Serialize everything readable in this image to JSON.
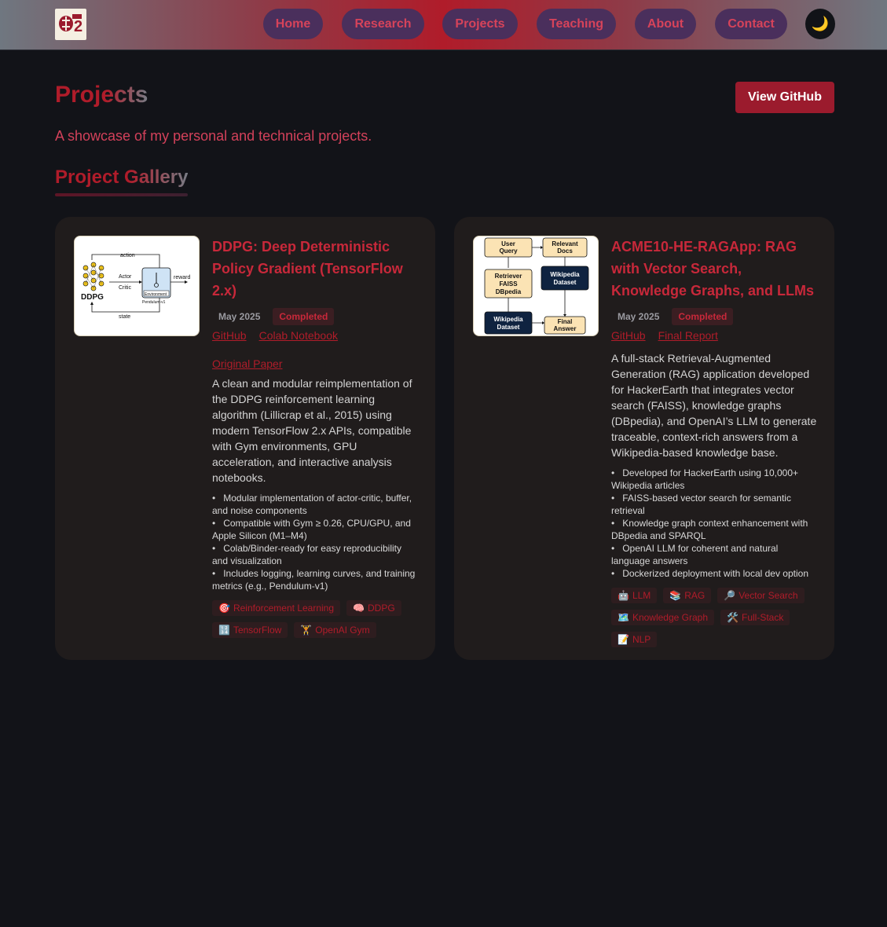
{
  "nav": {
    "logo_label": "logo",
    "items": [
      {
        "label": "Home"
      },
      {
        "label": "Research"
      },
      {
        "label": "Projects"
      },
      {
        "label": "Teaching"
      },
      {
        "label": "About"
      },
      {
        "label": "Contact"
      }
    ],
    "theme_icon": "🌙"
  },
  "page": {
    "title": "Projects",
    "subtitle": "A showcase of my personal and technical projects.",
    "github_button": "View GitHub",
    "section_title": "Project Gallery"
  },
  "projects": [
    {
      "title": "DDPG: Deep Deterministic Policy Gradient (TensorFlow 2.x)",
      "date": "May 2025",
      "status": "Completed",
      "links": [
        "GitHub",
        "Colab Notebook",
        "Original Paper"
      ],
      "description": "A clean and modular reimplementation of the DDPG reinforcement learning algorithm (Lillicrap et al., 2015) using modern TensorFlow 2.x APIs, compatible with Gym environments, GPU acceleration, and interactive analysis notebooks.",
      "features": [
        "Modular implementation of actor-critic, buffer, and noise components",
        "Compatible with Gym ≥ 0.26, CPU/GPU, and Apple Silicon (M1–M4)",
        "Colab/Binder-ready for easy reproducibility and visualization",
        "Includes logging, learning curves, and training metrics (e.g., Pendulum-v1)"
      ],
      "tags": [
        {
          "icon": "🎯",
          "label": "Reinforcement Learning"
        },
        {
          "icon": "🧠",
          "label": "DDPG"
        },
        {
          "icon": "🔢",
          "label": "TensorFlow"
        },
        {
          "icon": "🏋️",
          "label": "OpenAI Gym"
        }
      ],
      "diagram": {
        "labels": [
          "action",
          "Actor",
          "Critic",
          "reward",
          "DDPG",
          "Environment",
          "Pendulum-v1",
          "state"
        ]
      }
    },
    {
      "title": "ACME10-HE-RAGApp: RAG with Vector Search, Knowledge Graphs, and LLMs",
      "date": "May 2025",
      "status": "Completed",
      "links": [
        "GitHub",
        "Final Report"
      ],
      "description": "A full-stack Retrieval-Augmented Generation (RAG) application developed for HackerEarth that integrates vector search (FAISS), knowledge graphs (DBpedia), and OpenAI’s LLM to generate traceable, context-rich answers from a Wikipedia-based knowledge base.",
      "features": [
        "Developed for HackerEarth using 10,000+ Wikipedia articles",
        "FAISS-based vector search for semantic retrieval",
        "Knowledge graph context enhancement with DBpedia and SPARQL",
        "OpenAI LLM for coherent and natural language answers",
        "Dockerized deployment with local dev option"
      ],
      "tags": [
        {
          "icon": "🤖",
          "label": "LLM"
        },
        {
          "icon": "📚",
          "label": "RAG"
        },
        {
          "icon": "🔎",
          "label": "Vector Search"
        },
        {
          "icon": "🗺️",
          "label": "Knowledge Graph"
        },
        {
          "icon": "🛠️",
          "label": "Full-Stack"
        },
        {
          "icon": "📝",
          "label": "NLP"
        }
      ],
      "diagram": {
        "boxes": [
          "User Query",
          "Relevant Docs",
          "Retriever FAISS DBpedia",
          "Wikipedia Dataset",
          "Wikipedia Dataset",
          "Final Answer"
        ]
      }
    }
  ]
}
